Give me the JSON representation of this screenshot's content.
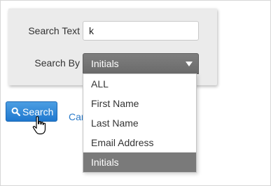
{
  "form": {
    "search_text_label": "Search Text",
    "search_text_value": "k",
    "search_by_label": "Search By",
    "search_by_selected": "Initials"
  },
  "dropdown": {
    "options": [
      {
        "label": "ALL",
        "selected": false
      },
      {
        "label": "First Name",
        "selected": false
      },
      {
        "label": "Last Name",
        "selected": false
      },
      {
        "label": "Email Address",
        "selected": false
      },
      {
        "label": "Initials",
        "selected": true
      }
    ]
  },
  "actions": {
    "search_label": "Search",
    "search_icon": "magnifier-icon",
    "cancel_label": "Can"
  },
  "colors": {
    "panel_bg": "#ebebeb",
    "select_bg": "#727272",
    "selected_option_bg": "#7a7a7a",
    "search_button_bg": "#2f86d6",
    "link_color": "#2a7ac9"
  },
  "cursor": "hand-pointer-icon"
}
